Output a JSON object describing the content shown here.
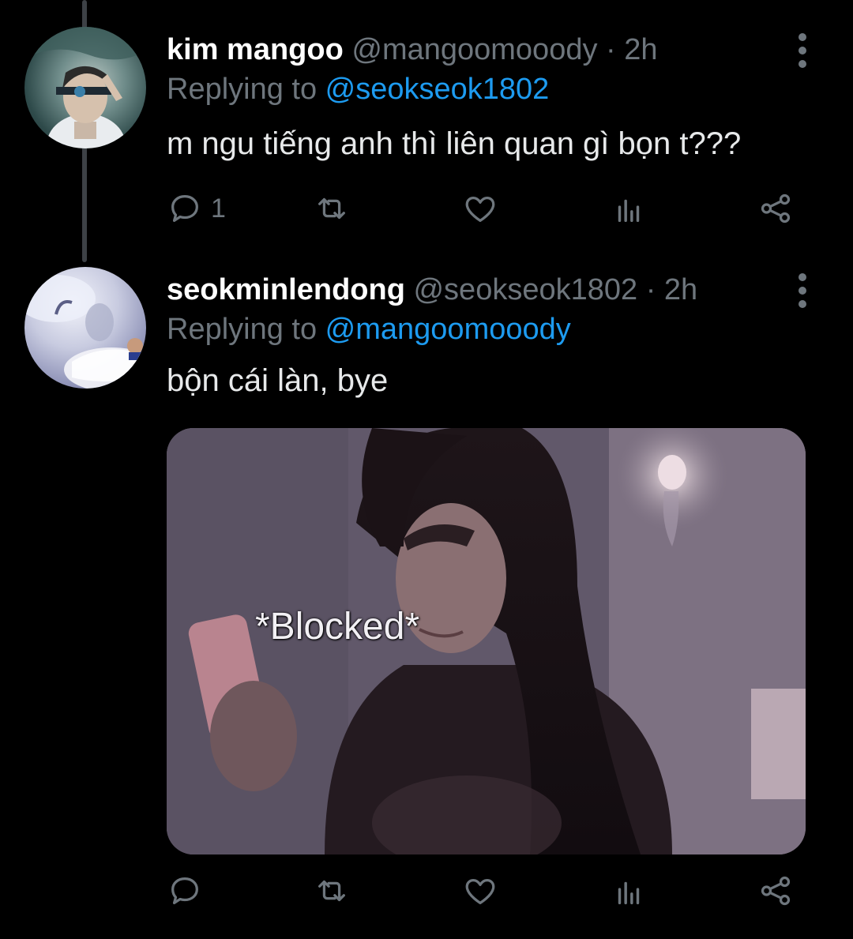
{
  "thread": {
    "tweets": [
      {
        "display_name": "kim mangoo",
        "handle": "@mangoomooody",
        "separator": " · ",
        "time": "2h",
        "replying_prefix": "Replying to ",
        "replying_to": "@seokseok1802",
        "text": "m ngu tiếng anh thì liên quan gì bọn t???",
        "reply_count": "1",
        "icons": {
          "avatar": "avatar-photo",
          "more": "more-vertical-icon",
          "reply": "reply-icon",
          "retweet": "retweet-icon",
          "like": "heart-icon",
          "stats": "stats-icon",
          "share": "share-icon"
        }
      },
      {
        "display_name": "seokminlendong",
        "handle": "@seokseok1802",
        "separator": " · ",
        "time": "2h",
        "replying_prefix": "Replying to ",
        "replying_to": "@mangoomooody",
        "text": "bộn cái làn, bye",
        "media_caption": "*Blocked*",
        "icons": {
          "avatar": "avatar-photo",
          "media": "meme-image",
          "more": "more-vertical-icon",
          "reply": "reply-icon",
          "retweet": "retweet-icon",
          "like": "heart-icon",
          "stats": "stats-icon",
          "share": "share-icon"
        }
      }
    ]
  },
  "colors": {
    "background": "#000000",
    "name": "#ffffff",
    "secondary": "#6e767d",
    "mention": "#1d9bf0",
    "body": "#e7e9ea"
  }
}
